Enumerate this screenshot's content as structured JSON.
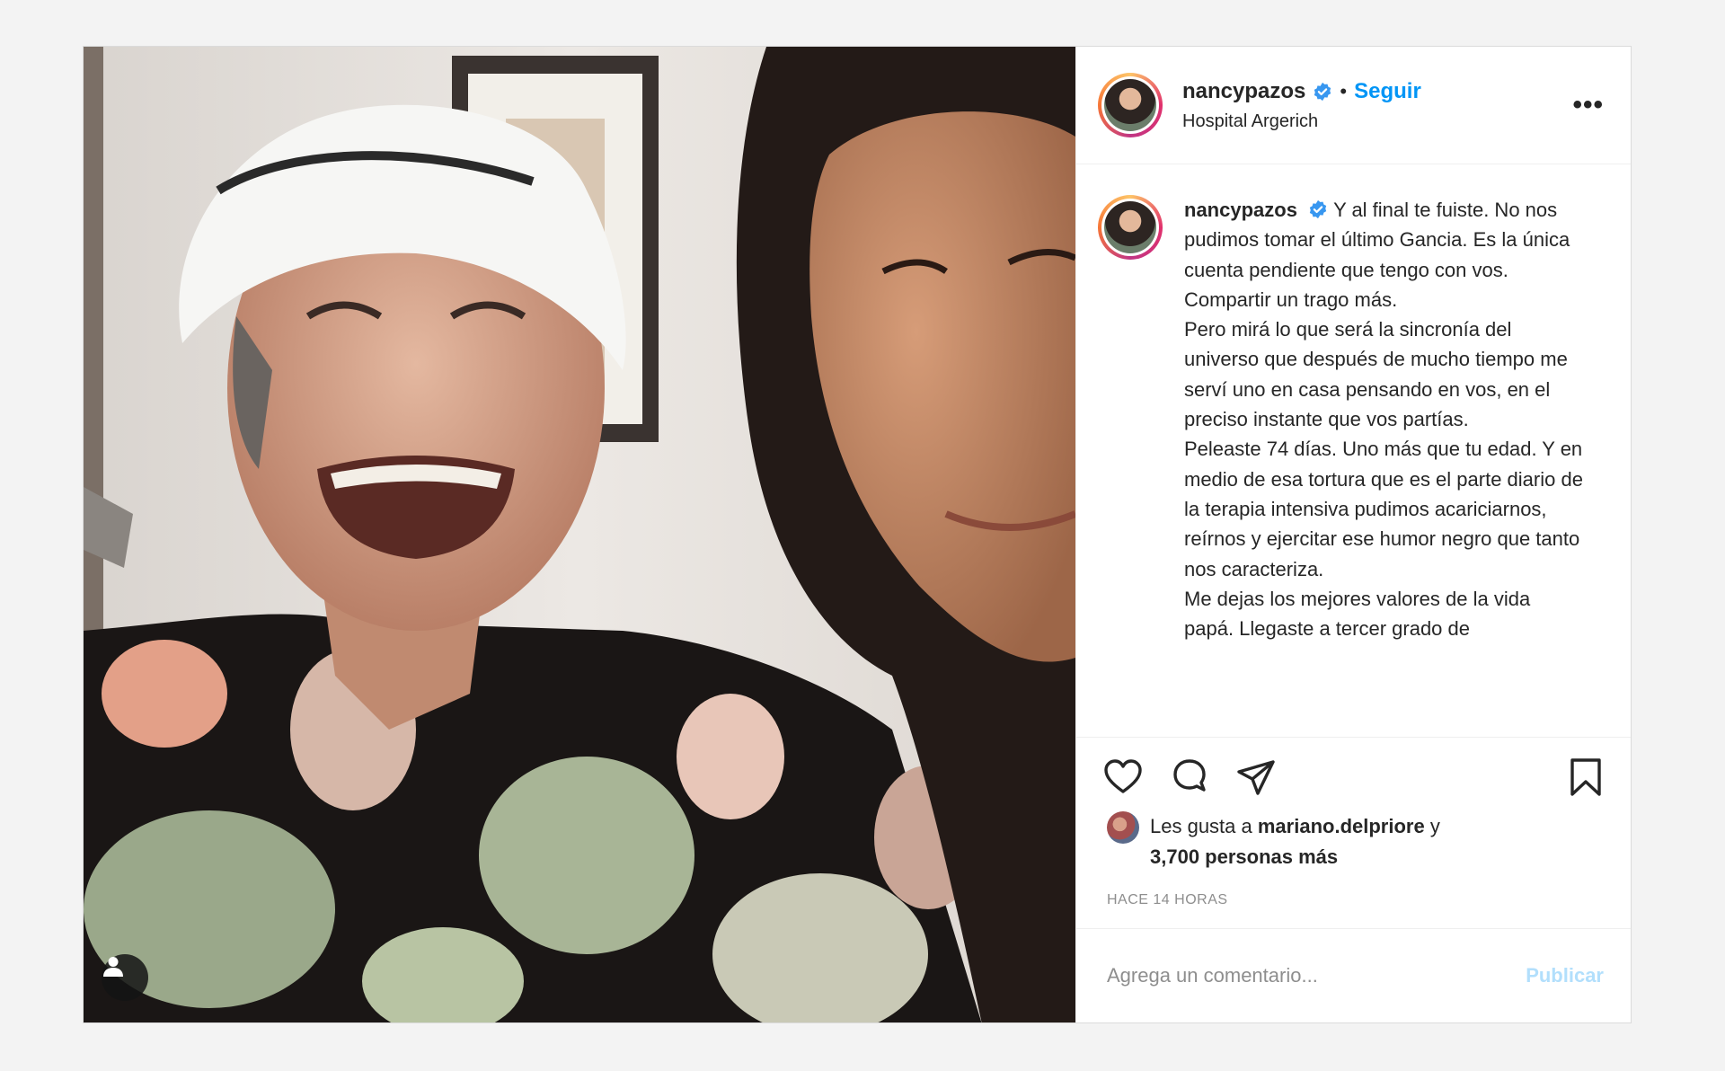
{
  "photo": {
    "alt_icon": "user-tag-icon"
  },
  "header": {
    "username": "nancypazos",
    "verified_icon": "verified-badge-icon",
    "separator": "•",
    "follow_label": "Seguir",
    "location": "Hospital Argerich",
    "more_icon": "more-options-icon",
    "more_label": "•••"
  },
  "caption": {
    "username": "nancypazos",
    "paragraphs": [
      "Y al final te fuiste. No nos pudimos tomar el último Gancia. Es la única cuenta pendiente que tengo con vos. Compartir un trago más.",
      "Pero mirá lo que será la sincronía del universo que después de mucho tiempo me serví uno en casa pensando en vos, en el preciso instante que vos partías.",
      "Peleaste 74 días. Uno más que tu edad. Y en medio de esa tortura que es el parte diario de la terapia intensiva pudimos acariciarnos, reírnos y ejercitar ese humor negro que tanto nos caracteriza.",
      "Me dejas los mejores valores de la vida papá. Llegaste a tercer grado de"
    ]
  },
  "actions": {
    "like_icon": "heart-icon",
    "comment_icon": "comment-icon",
    "share_icon": "send-icon",
    "save_icon": "bookmark-icon"
  },
  "likes": {
    "prefix": "Les gusta a",
    "user": "mariano.delpriore",
    "connector": "y",
    "others": "3,700 personas más"
  },
  "timestamp": "HACE 14 HORAS",
  "comment": {
    "placeholder": "Agrega un comentario...",
    "publish_label": "Publicar"
  },
  "colors": {
    "accent": "#0095f6",
    "publish_disabled": "#b2dffc",
    "muted": "#8e8e8e"
  }
}
